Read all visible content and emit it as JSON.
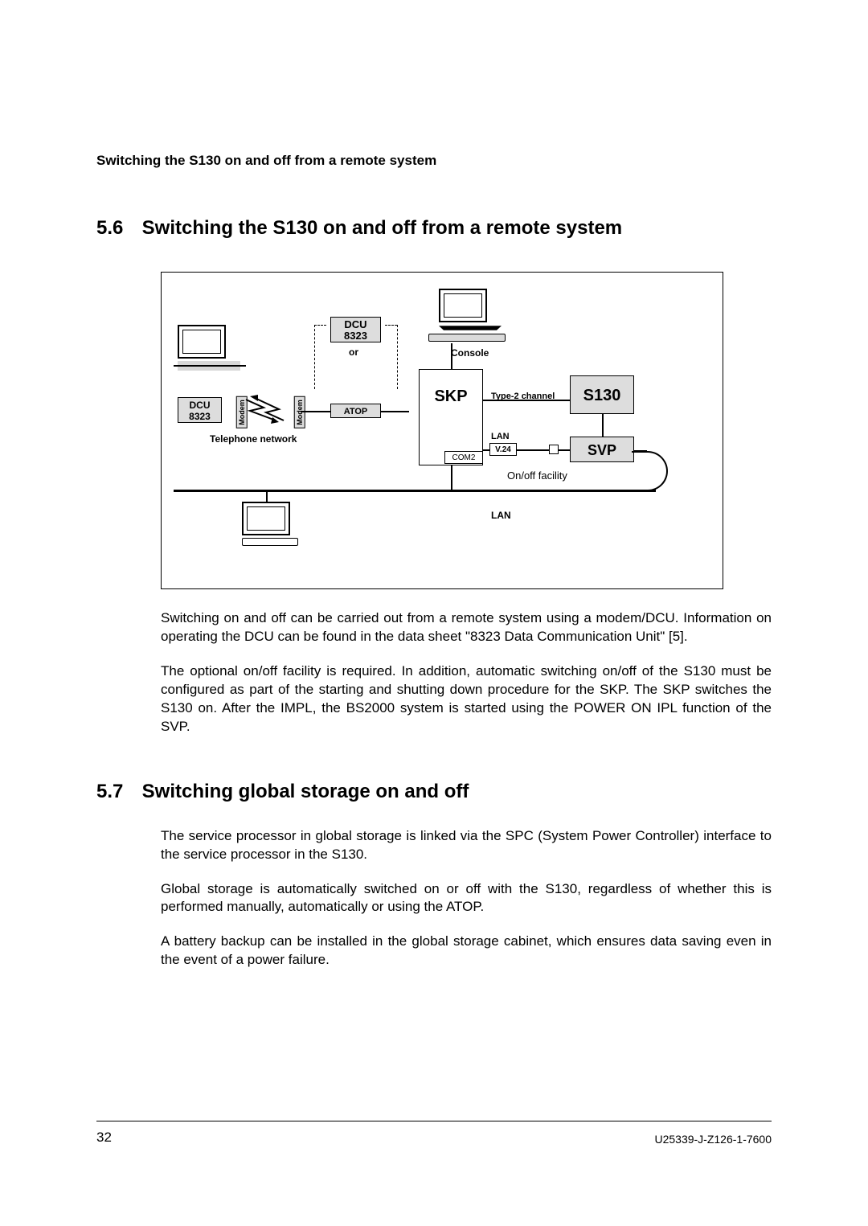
{
  "header": {
    "running": "Switching the S130 on and off from a remote system"
  },
  "sec56": {
    "num": "5.6",
    "title": "Switching the S130 on and off from a remote system",
    "p1": "Switching on and off can be carried out from a remote system using a modem/DCU. Information on operating the DCU can be found in the data sheet \"8323 Data Communication Unit\" [5].",
    "p2": "The optional on/off facility is required. In addition, automatic switching on/off of the S130 must be configured as part of the starting and shutting down procedure for the SKP. The SKP switches the S130 on. After the IMPL, the BS2000 system is started using the POWER ON IPL function of the SVP."
  },
  "sec57": {
    "num": "5.7",
    "title": "Switching global storage on and off",
    "p1": "The service processor in global storage is linked via the SPC (System Power Controller) interface to the service processor in the S130.",
    "p2": "Global storage is automatically switched on or off with the S130, regardless of whether this is performed manually, automatically or using the ATOP.",
    "p3": "A battery backup can be installed in the global storage cabinet, which ensures data saving even in the event of a power failure."
  },
  "diagram": {
    "dcu1": "DCU",
    "dcu1_sub": "8323",
    "or": "or",
    "dcu2": "DCU",
    "dcu2_sub": "8323",
    "modem": "Modem",
    "telnet": "Telephone network",
    "atop": "ATOP",
    "console": "Console",
    "skp": "SKP",
    "type2": "Type-2 channel",
    "s130": "S130",
    "lan1": "LAN",
    "v24": "V.24",
    "com2": "COM2",
    "svp": "SVP",
    "onoff": "On/off facility",
    "lan2": "LAN"
  },
  "footer": {
    "page": "32",
    "docid": "U25339-J-Z126-1-7600"
  }
}
